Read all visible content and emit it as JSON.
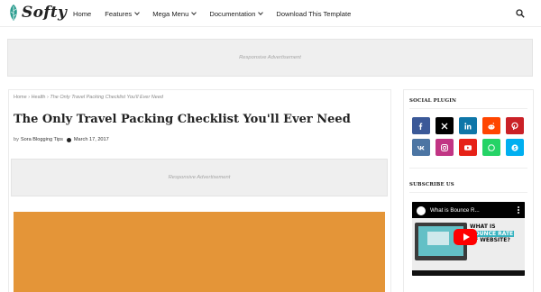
{
  "header": {
    "logo_text": "Softy",
    "nav": [
      {
        "label": "Home",
        "dropdown": false
      },
      {
        "label": "Features",
        "dropdown": true
      },
      {
        "label": "Mega Menu",
        "dropdown": true
      },
      {
        "label": "Documentation",
        "dropdown": true
      },
      {
        "label": "Download This Template",
        "dropdown": false
      }
    ],
    "search_icon": "search-icon"
  },
  "ads": {
    "top_label": "Responsive Advertisement",
    "main_label": "Responsive Advertisement"
  },
  "post": {
    "breadcrumb": {
      "home": "Home",
      "sep1": "›",
      "category": "Health",
      "sep2": "›",
      "current": "The Only Travel Packing Checklist You'll Ever Need"
    },
    "title": "The Only Travel Packing Checklist You'll Ever Need",
    "meta": {
      "by": "by",
      "author": "Sora Blogging Tips",
      "date": "March 17, 2017"
    },
    "hero_color": "#e49538"
  },
  "sidebar": {
    "social_title": "SOCIAL PLUGIN",
    "social": [
      {
        "name": "facebook",
        "color": "#3b5998"
      },
      {
        "name": "x",
        "color": "#000000"
      },
      {
        "name": "linkedin",
        "color": "#0e76a8"
      },
      {
        "name": "reddit",
        "color": "#ff4500"
      },
      {
        "name": "pinterest",
        "color": "#ca2127"
      },
      {
        "name": "vk",
        "color": "#4c75a3"
      },
      {
        "name": "instagram",
        "color": "#c13584"
      },
      {
        "name": "youtube",
        "color": "#e62117"
      },
      {
        "name": "whatsapp",
        "color": "#25d366"
      },
      {
        "name": "skype",
        "color": "#00aff0"
      }
    ],
    "subscribe_title": "SUBSCRIBE US",
    "video": {
      "title": "What is Bounce R...",
      "line1": "WHAT IS",
      "line2": "BOUNCE RATE",
      "line3": "OF WEBSITE?"
    }
  }
}
